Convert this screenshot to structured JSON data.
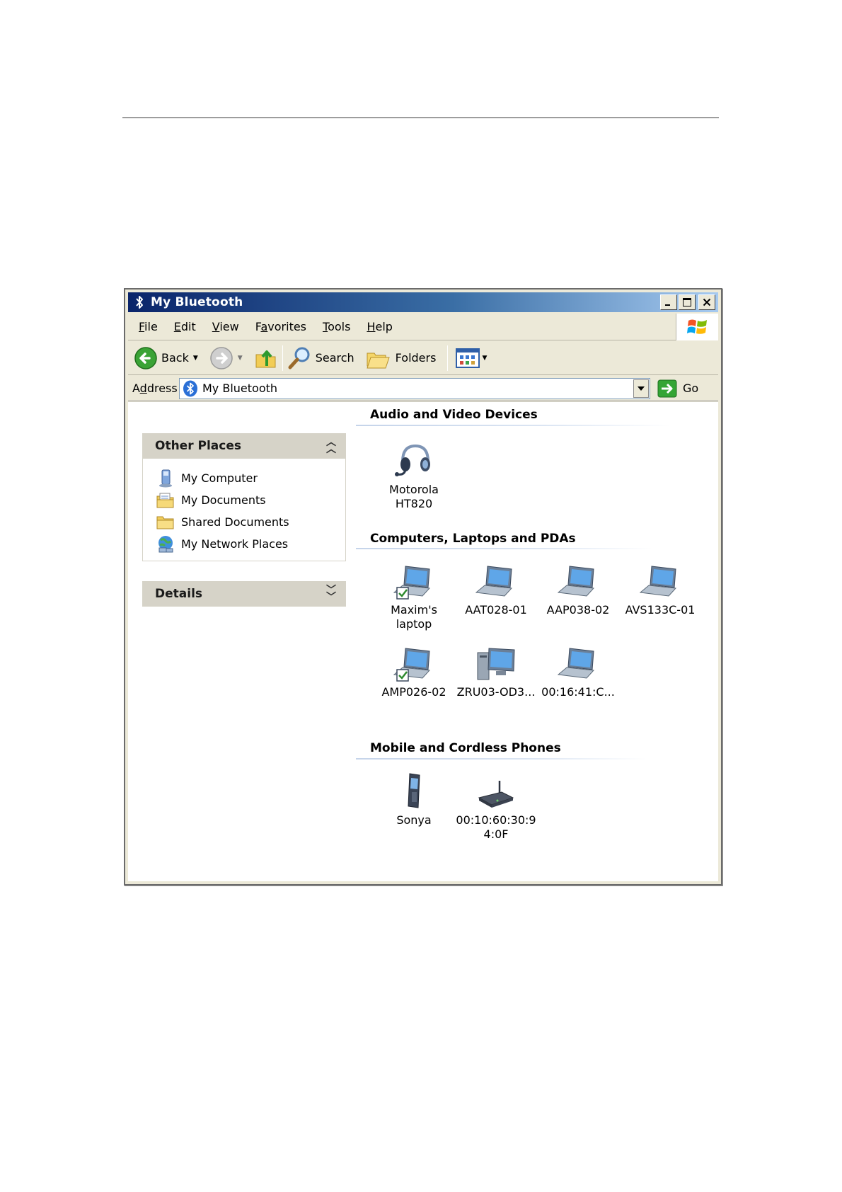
{
  "window": {
    "title": "My Bluetooth",
    "title_gradient": [
      "#0a246a",
      "#a6caf0"
    ]
  },
  "menu": {
    "items": [
      {
        "accel": "F",
        "rest": "ile"
      },
      {
        "accel": "E",
        "rest": "dit"
      },
      {
        "accel": "V",
        "rest": "iew"
      },
      {
        "pre": "F",
        "accel": "a",
        "rest": "vorites"
      },
      {
        "accel": "T",
        "rest": "ools"
      },
      {
        "accel": "H",
        "rest": "elp"
      }
    ]
  },
  "toolbar": {
    "back_label": "Back",
    "search_label": "Search",
    "folders_label": "Folders"
  },
  "address": {
    "label_pre": "A",
    "label_accel": "d",
    "label_rest": "dress",
    "value": "My Bluetooth",
    "go_label": "Go"
  },
  "taskpane": {
    "other_places": {
      "title": "Other Places",
      "items": [
        {
          "label": "My Computer",
          "icon": "computer-icon"
        },
        {
          "label": "My Documents",
          "icon": "documents-icon"
        },
        {
          "label": "Shared Documents",
          "icon": "folder-icon"
        },
        {
          "label": "My Network Places",
          "icon": "network-icon"
        }
      ]
    },
    "details": {
      "title": "Details"
    }
  },
  "groups": {
    "audio": {
      "title": "Audio and Video Devices",
      "items": [
        {
          "line1": "Motorola",
          "line2": "HT820",
          "icon": "headset-icon"
        }
      ]
    },
    "computers": {
      "title": "Computers, Laptops and PDAs",
      "items": [
        {
          "line1": "Maxim's laptop",
          "icon": "laptop-paired-icon"
        },
        {
          "line1": "AAT028-01",
          "icon": "laptop-icon"
        },
        {
          "line1": "AAP038-02",
          "icon": "laptop-icon"
        },
        {
          "line1": "AVS133C-01",
          "icon": "laptop-icon"
        },
        {
          "line1": "AMP026-02",
          "icon": "laptop-paired-icon"
        },
        {
          "line1": "ZRU03-OD3...",
          "icon": "desktop-icon"
        },
        {
          "line1": "00:16:41:C...",
          "icon": "laptop-icon"
        }
      ]
    },
    "phones": {
      "title": "Mobile and Cordless Phones",
      "items": [
        {
          "line1": "Sonya",
          "icon": "mobile-phone-icon"
        },
        {
          "line1": "00:10:60:30:9",
          "line2": "4:0F",
          "icon": "access-point-icon"
        }
      ]
    }
  }
}
